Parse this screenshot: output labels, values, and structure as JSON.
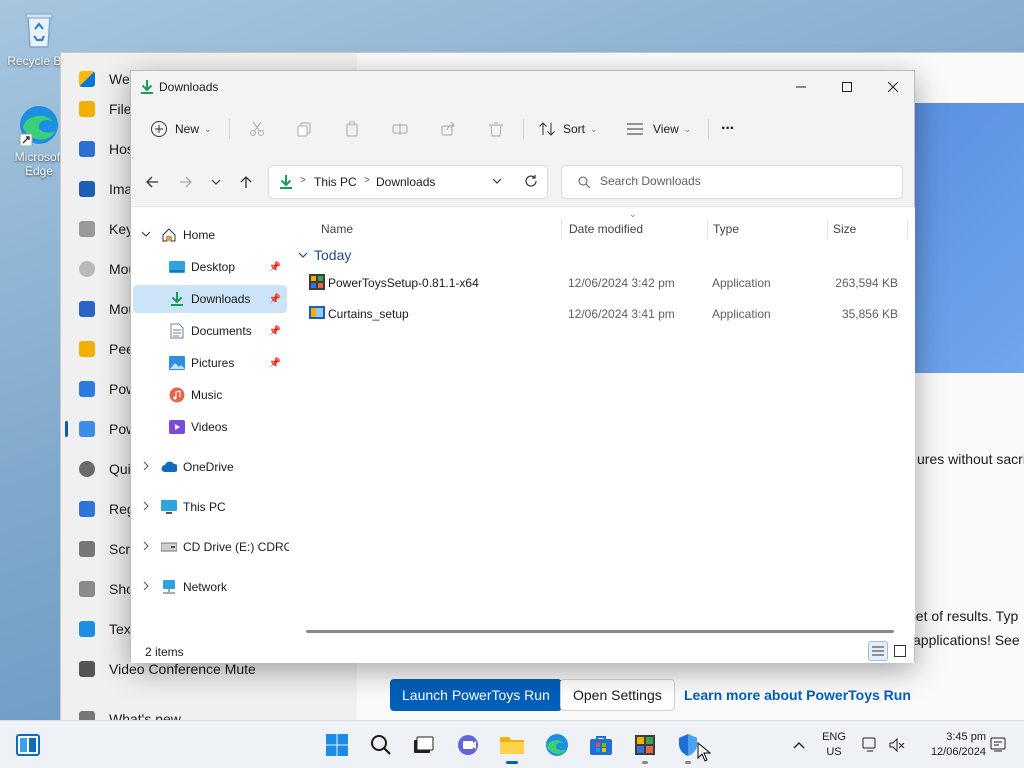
{
  "desktop": {
    "icons": [
      {
        "label": "Recycle Bin"
      },
      {
        "label": "Microsoft Edge"
      }
    ]
  },
  "powertoys": {
    "nav_items": [
      "Welcome",
      "File",
      "Hosts",
      "Image",
      "Keyboard",
      "Mouse",
      "Mouse",
      "Peek",
      "Power",
      "Power",
      "Quick",
      "Registry",
      "Screen",
      "Shortcut",
      "Text",
      "Video Conference Mute",
      "What's new"
    ],
    "text_features": "ures without sacrifi",
    "text_results": "bset of results. Typ",
    "text_apps": "applications! See",
    "buttons": {
      "launch": "Launch PowerToys Run",
      "settings": "Open Settings",
      "learn": "Learn more about PowerToys Run"
    }
  },
  "explorer": {
    "title": "Downloads",
    "toolbar": {
      "new_label": "New",
      "sort_label": "Sort",
      "view_label": "View",
      "more_label": "···"
    },
    "address": {
      "parts": [
        "This PC",
        "Downloads"
      ],
      "sep": ">"
    },
    "search_placeholder": "Search Downloads",
    "nav": {
      "home": "Home",
      "quick": [
        {
          "label": "Desktop",
          "pinned": true
        },
        {
          "label": "Downloads",
          "pinned": true,
          "selected": true
        },
        {
          "label": "Documents",
          "pinned": true
        },
        {
          "label": "Pictures",
          "pinned": true
        },
        {
          "label": "Music"
        },
        {
          "label": "Videos"
        }
      ],
      "onedrive": "OneDrive",
      "thispc": "This PC",
      "cddrive": "CD Drive (E:) CDROM",
      "network": "Network"
    },
    "columns": [
      "Name",
      "Date modified",
      "Type",
      "Size"
    ],
    "group_label": "Today",
    "files": [
      {
        "name": "PowerToysSetup-0.81.1-x64",
        "date": "12/06/2024 3:42 pm",
        "type": "Application",
        "size": "263,594 KB"
      },
      {
        "name": "Curtains_setup",
        "date": "12/06/2024 3:41 pm",
        "type": "Application",
        "size": "35,856 KB"
      }
    ],
    "status": "2 items"
  },
  "taskbar": {
    "lang_top": "ENG",
    "lang_bottom": "US",
    "time": "3:45 pm",
    "date": "12/06/2024"
  },
  "colors": {
    "accent": "#005fb8",
    "selection": "#cce4f7",
    "group": "#1e4e8a"
  }
}
